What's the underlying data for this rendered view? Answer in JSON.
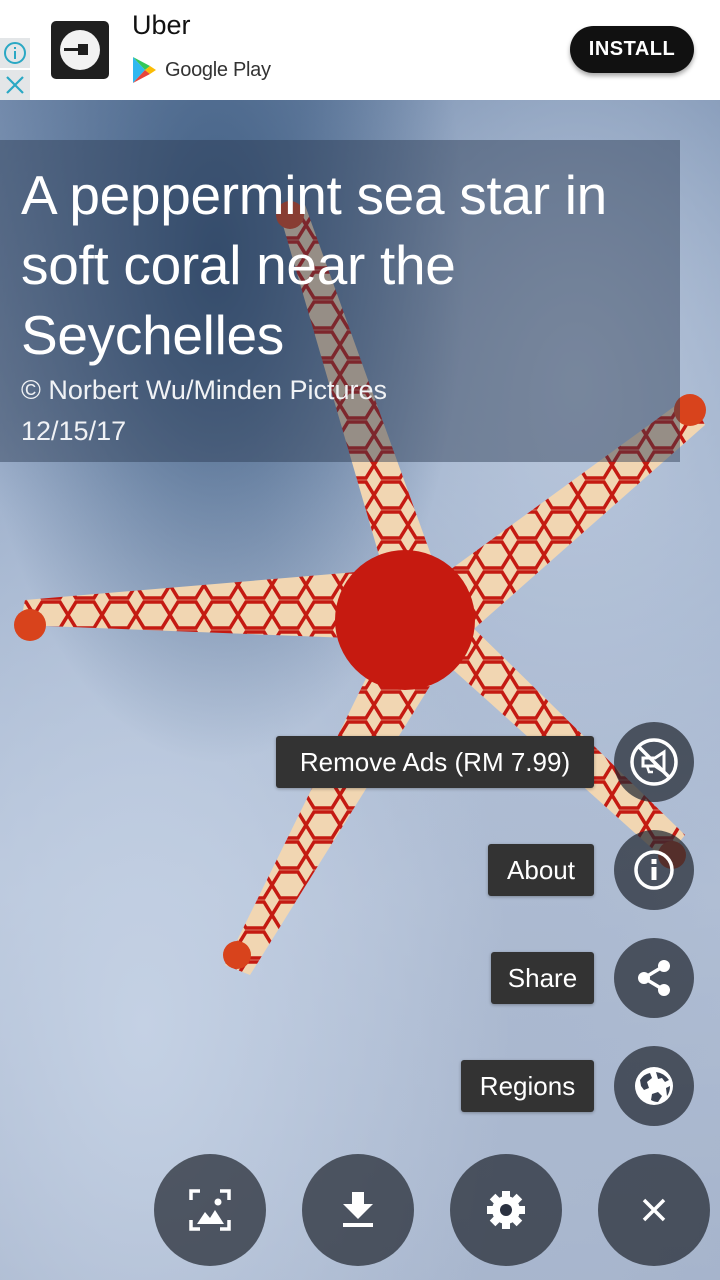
{
  "ad": {
    "app_name": "Uber",
    "store_label": "Google Play",
    "install_label": "INSTALL",
    "info_icon": "info-icon",
    "close_icon": "close-icon"
  },
  "caption": {
    "title": "A peppermint sea star in soft coral near the Seychelles",
    "credit": "© Norbert Wu/Minden Pictures",
    "date": "12/15/17"
  },
  "menu": {
    "items": [
      {
        "label": "Remove Ads (RM 7.99)",
        "icon": "no-ads-icon"
      },
      {
        "label": "About",
        "icon": "info-icon"
      },
      {
        "label": "Share",
        "icon": "share-icon"
      },
      {
        "label": "Regions",
        "icon": "globe-icon"
      }
    ]
  },
  "bottom_bar": {
    "buttons": [
      {
        "name": "set-wallpaper",
        "icon": "wallpaper-icon"
      },
      {
        "name": "download",
        "icon": "download-icon"
      },
      {
        "name": "settings",
        "icon": "gear-icon"
      },
      {
        "name": "close",
        "icon": "close-icon"
      }
    ]
  }
}
